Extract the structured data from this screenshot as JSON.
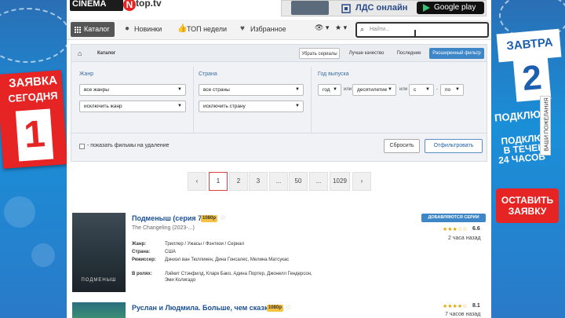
{
  "left_banner": {
    "line1": "ЗАЯВКА",
    "line2": "СЕГОДНЯ",
    "number": "1"
  },
  "right_banner": {
    "line1": "ЗАВТРА",
    "number": "2",
    "line2": "ПОДКЛЮ",
    "line3": "ПОДКЛЮ В ТЕЧЕН 24 ЧАСОВ",
    "button": "ОСТАВИТЬ ЗАЯВКУ",
    "wishes": "ВАШИ ПОЖЕЛАНИЯ"
  },
  "logo": {
    "cinema": "CINEMA",
    "n": "N",
    "top": "top.tv"
  },
  "promo": {
    "lds": "ЛДС онлайн",
    "google_play": "Google play"
  },
  "nav": {
    "catalog": "Каталог",
    "items": [
      "Новинки",
      "ТОП недели",
      "Избранное"
    ],
    "search_placeholder": "Найти..."
  },
  "filter": {
    "breadcrumb": "Каталог",
    "buttons": [
      "Убрать сериалы",
      "Лучше качество",
      "Последние",
      "Расширенный фильтр"
    ],
    "genre": {
      "label": "Жанр",
      "include": "все жанры",
      "exclude": "исключить жанр"
    },
    "country": {
      "label": "Страна",
      "include": "все страны",
      "exclude": "исключить страну"
    },
    "year": {
      "label": "Год выпуска",
      "mode": "год",
      "or1": "или",
      "decade": "десятилетие",
      "or2": "или",
      "from": "с",
      "dash": "-",
      "to": "по"
    },
    "show_removed": "- показать фильмы на удаление",
    "reset": "Сбросить",
    "apply": "Отфильтровать"
  },
  "pagination": {
    "pages": [
      "1",
      "2",
      "3",
      "...",
      "50",
      "...",
      "1029"
    ],
    "current": "1"
  },
  "films": [
    {
      "title": "Подменыш (серия 7)",
      "quality": "1080p",
      "original": "The Changeling (2023-...)",
      "poster_title": "ПОДМЕНЫШ",
      "status": "ДОБАВЛЯЮТСЯ СЕРИИ",
      "rating": "6.6",
      "rating_stars": "★★★☆☆",
      "ago": "2 часа назад",
      "genre_key": "Жанр:",
      "genre": "Триллер / Ужасы / Фэнтези / Сериал",
      "country_key": "Страна:",
      "country": "США",
      "director_key": "Режиссер:",
      "director": "Дэниэл ван Тюлликен, Дина Гонсалес, Мелина Матсукас",
      "cast_key": "В ролях:",
      "cast": "Лэйкит Стэнфилд, Кларк Бако, Адина Портер, Джонелл Гендерсон, Эми Колигадо"
    },
    {
      "title": "Руслан и Людмила. Больше, чем сказка",
      "quality": "1080p",
      "rating": "8.1",
      "rating_stars": "★★★★☆",
      "ago": "7 часов назад"
    }
  ]
}
